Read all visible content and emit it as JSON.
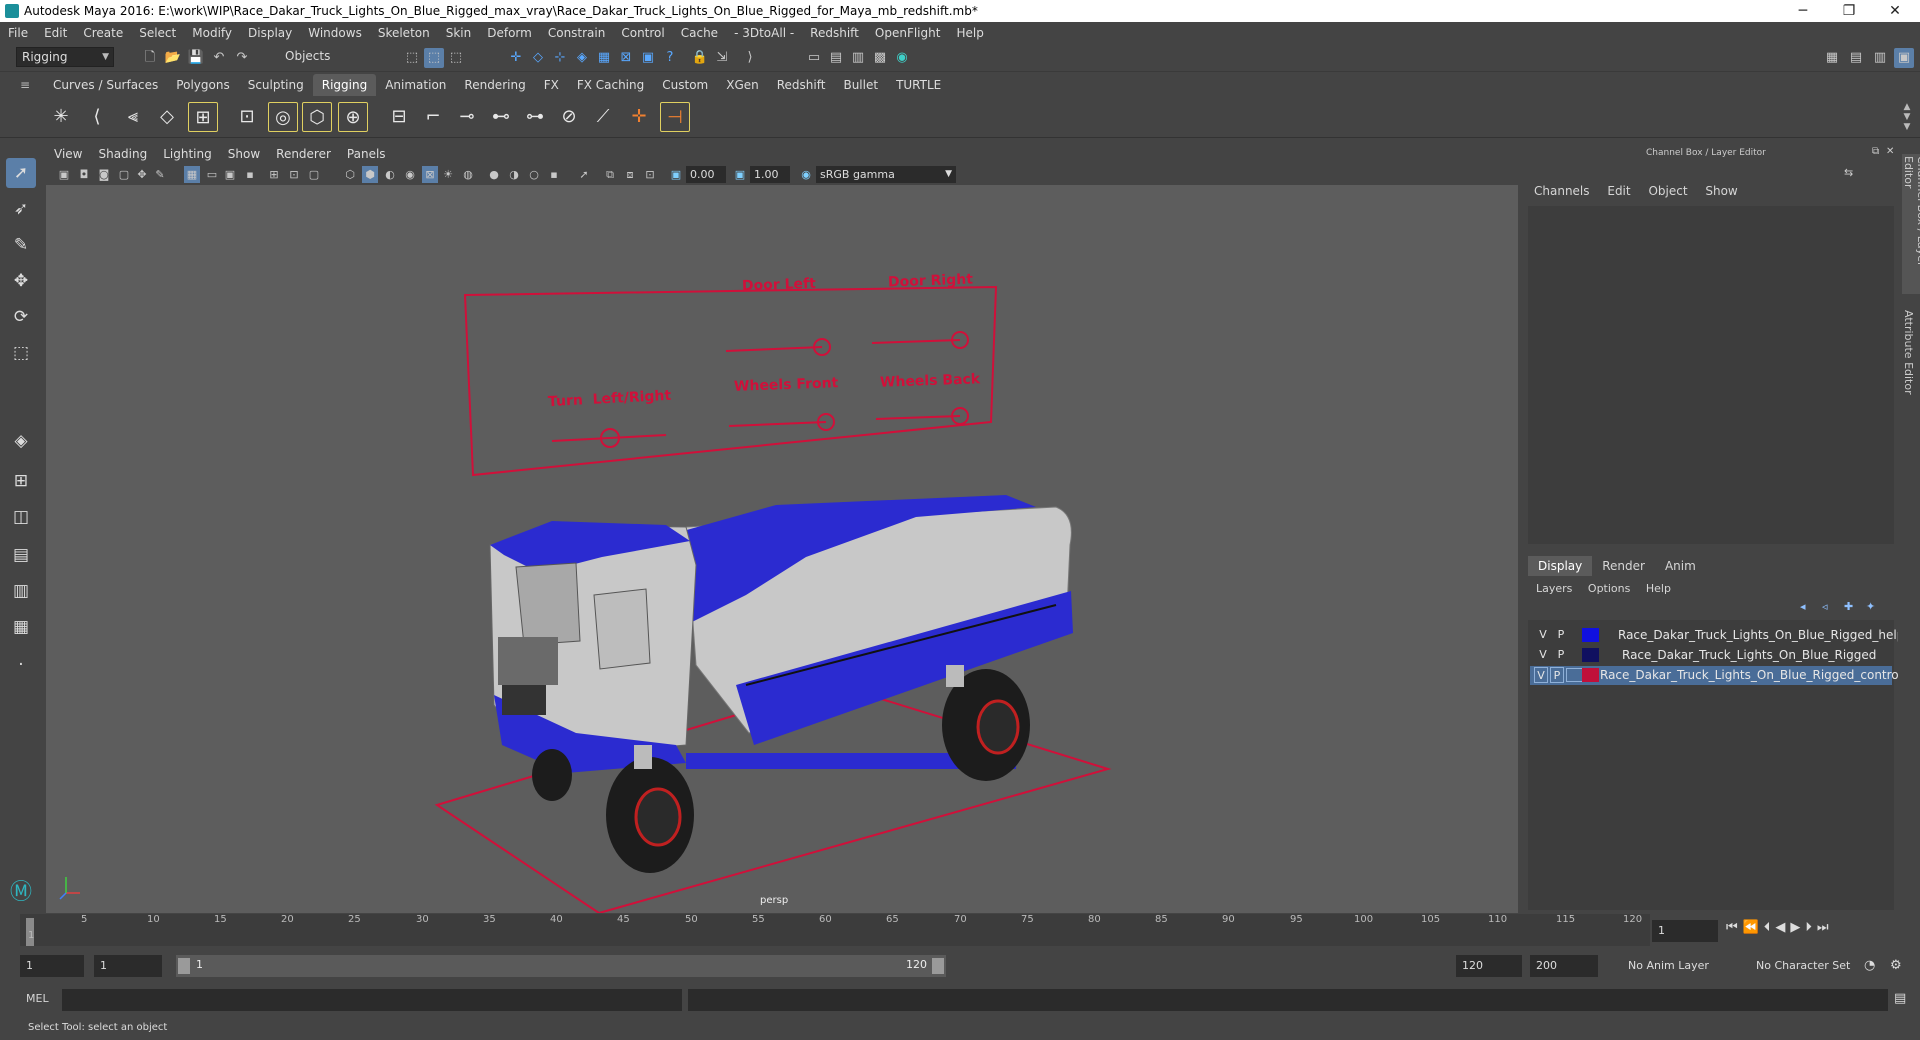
{
  "window": {
    "title": "Autodesk Maya 2016: E:\\work\\WIP\\Race_Dakar_Truck_Lights_On_Blue_Rigged_max_vray\\Race_Dakar_Truck_Lights_On_Blue_Rigged_for_Maya_mb_redshift.mb*",
    "minimize": "─",
    "restore": "❐",
    "close": "✕"
  },
  "menubar": [
    "File",
    "Edit",
    "Create",
    "Select",
    "Modify",
    "Display",
    "Windows",
    "Skeleton",
    "Skin",
    "Deform",
    "Constrain",
    "Control",
    "Cache",
    "- 3DtoAll -",
    "Redshift",
    "OpenFlight",
    "Help"
  ],
  "statusline": {
    "mode_value": "Rigging",
    "selection_mask": "Objects"
  },
  "shelf_tabs": [
    "Curves / Surfaces",
    "Polygons",
    "Sculpting",
    "Rigging",
    "Animation",
    "Rendering",
    "FX",
    "FX Caching",
    "Custom",
    "XGen",
    "Redshift",
    "Bullet",
    "TURTLE"
  ],
  "active_shelf_tab": "Rigging",
  "viewport": {
    "menu": [
      "View",
      "Shading",
      "Lighting",
      "Show",
      "Renderer",
      "Panels"
    ],
    "exposure": "0.00",
    "gamma": "1.00",
    "color_space": "sRGB gamma",
    "camera_label": "persp"
  },
  "control_panel": {
    "labels": {
      "door_left": "Door Left",
      "door_right": "Door Right",
      "turn": "Turn  Left/Right",
      "wheels_front": "Wheels Front",
      "wheels_back": "Wheels Back"
    },
    "color": "#d0103a"
  },
  "channel_box": {
    "title": "Channel Box / Layer Editor",
    "menu": [
      "Channels",
      "Edit",
      "Object",
      "Show"
    ]
  },
  "layer_editor": {
    "tabs": [
      "Display",
      "Render",
      "Anim"
    ],
    "active_tab": "Display",
    "menu": [
      "Layers",
      "Options",
      "Help"
    ],
    "layers": [
      {
        "v": "V",
        "p": "P",
        "color": "#1010e0",
        "name": "Race_Dakar_Truck_Lights_On_Blue_Rigged_helpers",
        "selected": false
      },
      {
        "v": "V",
        "p": "P",
        "color": "#101060",
        "name": "Race_Dakar_Truck_Lights_On_Blue_Rigged",
        "selected": false
      },
      {
        "v": "V",
        "p": "P",
        "color": "#c0103a",
        "name": "Race_Dakar_Truck_Lights_On_Blue_Rigged_controllers",
        "selected": true
      }
    ]
  },
  "side_tabs": [
    "Channel Box / Layer Editor",
    "Attribute Editor"
  ],
  "timeline": {
    "ticks": [
      "1",
      "5",
      "10",
      "15",
      "20",
      "25",
      "30",
      "35",
      "40",
      "45",
      "50",
      "55",
      "60",
      "65",
      "70",
      "75",
      "80",
      "85",
      "90",
      "95",
      "100",
      "105",
      "110",
      "115",
      "120"
    ],
    "current_frame": "1"
  },
  "range": {
    "start": "1",
    "playback_start": "1",
    "slider_start": "1",
    "slider_end": "120",
    "playback_end": "120",
    "end": "200",
    "anim_layer": "No Anim Layer",
    "character_set": "No Character Set"
  },
  "command_line": {
    "label": "MEL"
  },
  "help_line": "Select Tool: select an object"
}
